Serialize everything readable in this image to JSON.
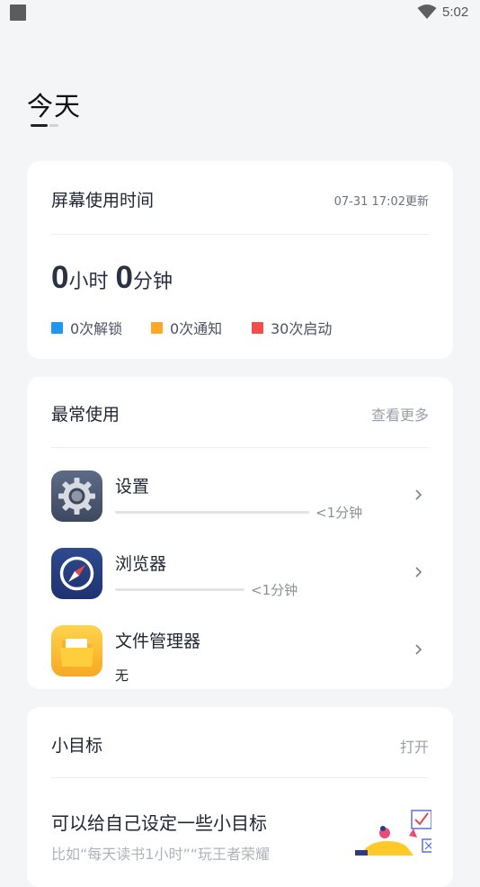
{
  "status": {
    "time": "5:02",
    "square_icon": "notification-square-icon",
    "wifi_icon": "wifi-icon"
  },
  "page": {
    "title": "今天"
  },
  "screen_time": {
    "title": "屏幕使用时间",
    "updated": "07-31 17:02更新",
    "hours": "0",
    "hours_unit": "小时",
    "minutes": "0",
    "minutes_unit": "分钟",
    "legend": [
      {
        "label": "0次解锁",
        "color": "#2196f3"
      },
      {
        "label": "0次通知",
        "color": "#ffa726"
      },
      {
        "label": "30次启动",
        "color": "#f44b4b"
      }
    ]
  },
  "most_used": {
    "title": "最常使用",
    "more": "查看更多",
    "apps": [
      {
        "name": "设置",
        "duration": "<1分钟",
        "icon": "settings-gear-icon"
      },
      {
        "name": "浏览器",
        "duration": "<1分钟",
        "icon": "browser-compass-icon"
      },
      {
        "name": "文件管理器",
        "duration": "无",
        "icon": "folder-icon"
      }
    ]
  },
  "goals": {
    "title": "小目标",
    "open": "打开",
    "headline": "可以给自己设定一些小目标",
    "sub": "比如“每天读书1小时”“玩王者荣耀"
  }
}
